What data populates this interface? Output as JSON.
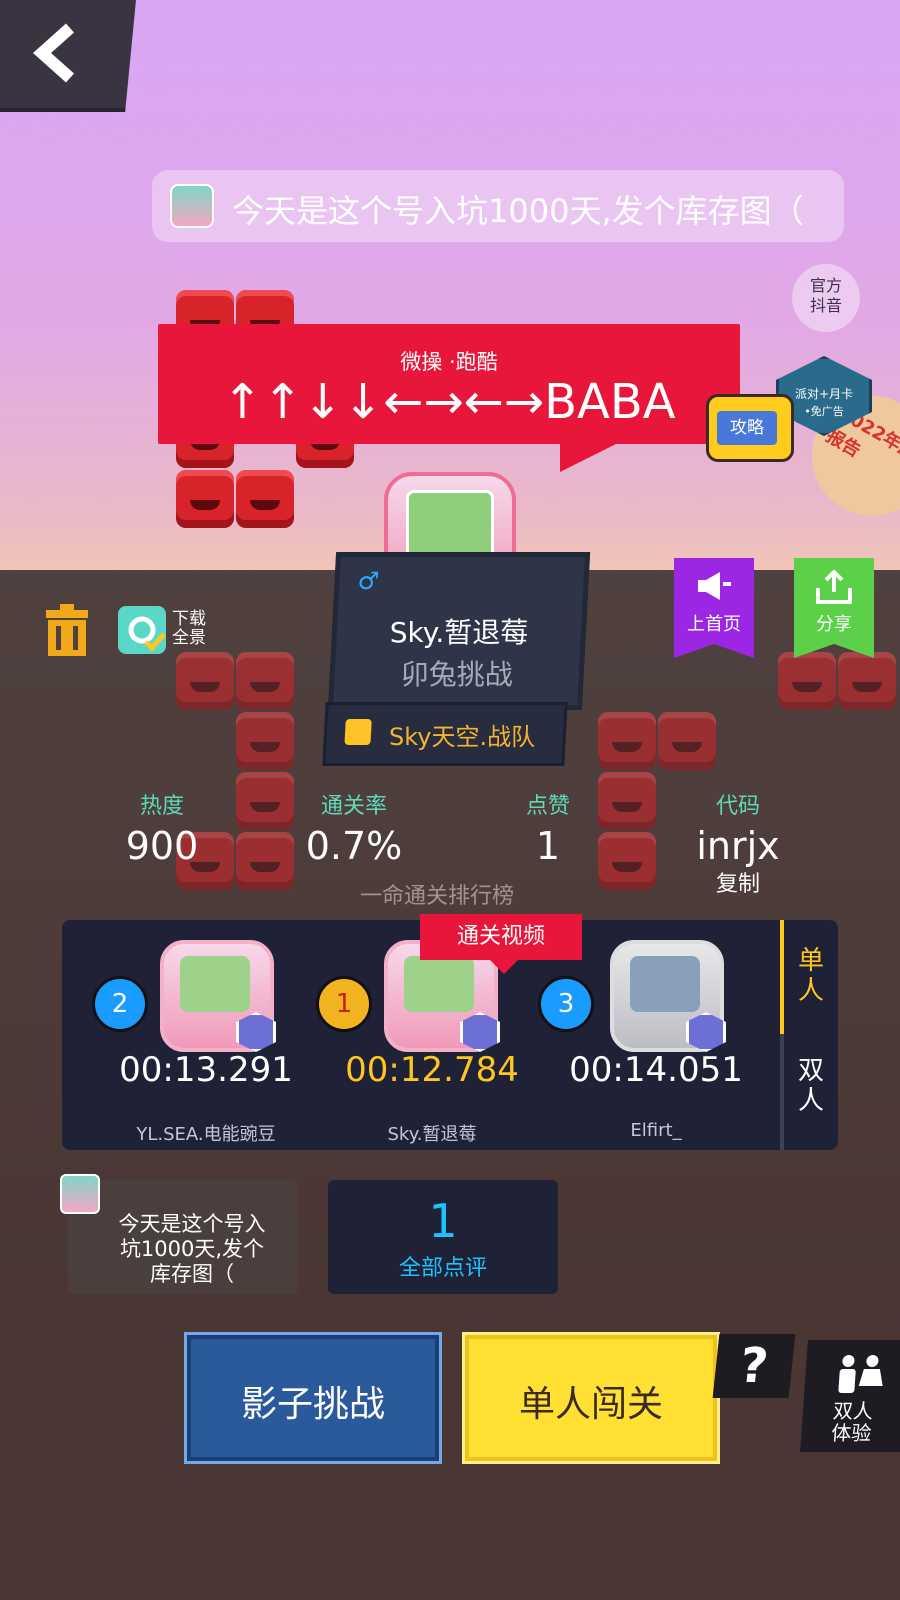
{
  "header": {
    "back_icon": "chevron-left-icon"
  },
  "message": {
    "text": "今天是这个号入坑1000天,发个库存图（"
  },
  "official": {
    "label": "官方抖音",
    "line1": "官方",
    "line2": "抖音"
  },
  "level": {
    "tags": "微操  ·跑酷",
    "title": "↑↑↓↓←→←→BABA",
    "author": "Sky.暂退莓",
    "author_title": "卯兔挑战",
    "gender_icon": "male-icon",
    "team": "Sky天空.战队"
  },
  "side_badges": {
    "guide": "攻略",
    "party_line1": "派对+月卡",
    "party_line2": "•免广告",
    "report": "2022年度报告"
  },
  "tools": {
    "download_line1": "下载",
    "download_line2": "全景"
  },
  "actions": {
    "promote": "上首页",
    "share": "分享"
  },
  "stats": {
    "heat_label": "热度",
    "heat_value": "900",
    "clear_rate_label": "通关率",
    "clear_rate_value": "0.7%",
    "likes_label": "点赞",
    "likes_value": "1",
    "code_label": "代码",
    "code_value": "inrjx",
    "copy_label": "复制"
  },
  "leaderboard": {
    "title": "一命通关排行榜",
    "video_tag": "通关视频",
    "entries": [
      {
        "rank": "2",
        "time": "00:13.291",
        "name": "YL.SEA.电能豌豆"
      },
      {
        "rank": "1",
        "time": "00:12.784",
        "name": "Sky.暂退莓"
      },
      {
        "rank": "3",
        "time": "00:14.051",
        "name": "Elfirt_"
      }
    ],
    "tab_single": "单人",
    "tab_double": "双人",
    "tab_single_line1": "单",
    "tab_single_line2": "人",
    "tab_double_line1": "双",
    "tab_double_line2": "人"
  },
  "comment": {
    "line1": "今天是这个号入",
    "line2": "坑1000天,发个",
    "line3": "库存图（"
  },
  "reviews": {
    "count": "1",
    "label": "全部点评"
  },
  "buttons": {
    "shadow_challenge": "影子挑战",
    "solo_play": "单人闯关",
    "help": "?",
    "duo_line1": "双人",
    "duo_line2": "体验"
  },
  "colors": {
    "accent_red": "#e8163a",
    "accent_yellow": "#ffc61e",
    "accent_cyan": "#1dc3ff",
    "panel": "#1f2236"
  }
}
